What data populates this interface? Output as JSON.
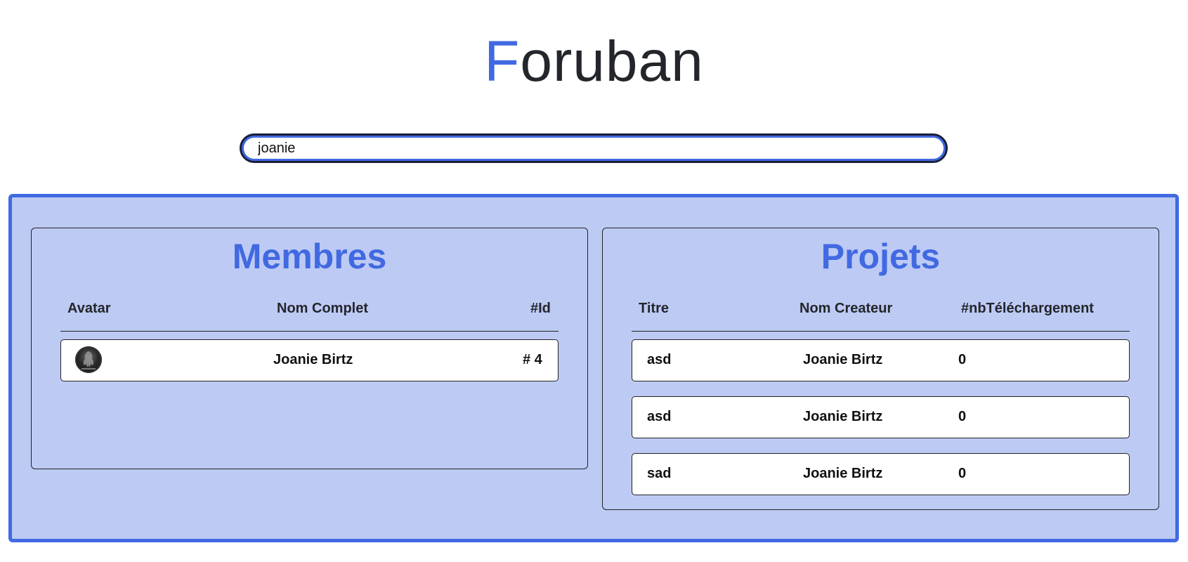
{
  "header": {
    "logo_first_letter": "F",
    "logo_rest": "oruban"
  },
  "search": {
    "value": "joanie"
  },
  "colors": {
    "accent": "#4169e1",
    "results_background": "#bdcaf4",
    "text_dark": "#23262b"
  },
  "members": {
    "title": "Membres",
    "columns": {
      "avatar": "Avatar",
      "name": "Nom Complet",
      "id": "#Id"
    },
    "rows": [
      {
        "avatar_icon": "avatar-icon",
        "name": "Joanie Birtz",
        "id": "# 4"
      }
    ]
  },
  "projects": {
    "title": "Projets",
    "columns": {
      "title": "Titre",
      "creator": "Nom Createur",
      "downloads": "#nbTéléchargement"
    },
    "rows": [
      {
        "title": "asd",
        "creator": "Joanie Birtz",
        "downloads": "0"
      },
      {
        "title": "asd",
        "creator": "Joanie Birtz",
        "downloads": "0"
      },
      {
        "title": "sad",
        "creator": "Joanie Birtz",
        "downloads": "0"
      }
    ]
  }
}
